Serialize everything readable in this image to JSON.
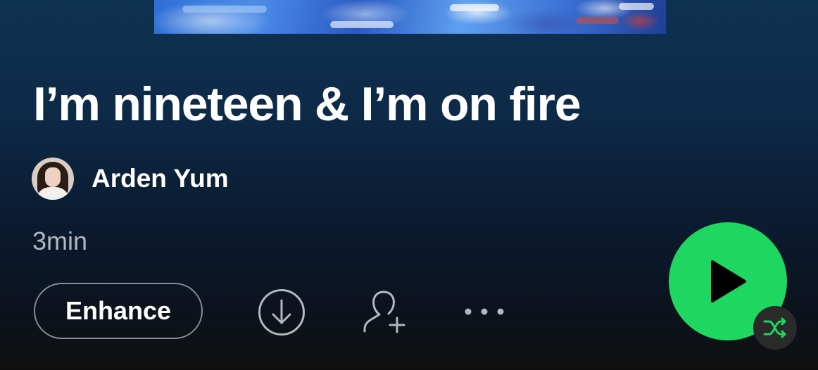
{
  "playlist": {
    "title": "I’m nineteen & I’m on fire",
    "owner": "Arden Yum",
    "duration": "3min"
  },
  "actions": {
    "enhance_label": "Enhance",
    "download_icon": "download-circle-icon",
    "add_collaborator_icon": "add-user-icon",
    "more_icon": "more-options-icon",
    "play_icon": "play-icon",
    "shuffle_icon": "shuffle-icon"
  },
  "colors": {
    "accent": "#1ed760",
    "text_primary": "#ffffff",
    "text_secondary": "#b3b8c0",
    "button_border": "#8a8d92",
    "shuffle_badge_bg": "#2a2a2a"
  }
}
